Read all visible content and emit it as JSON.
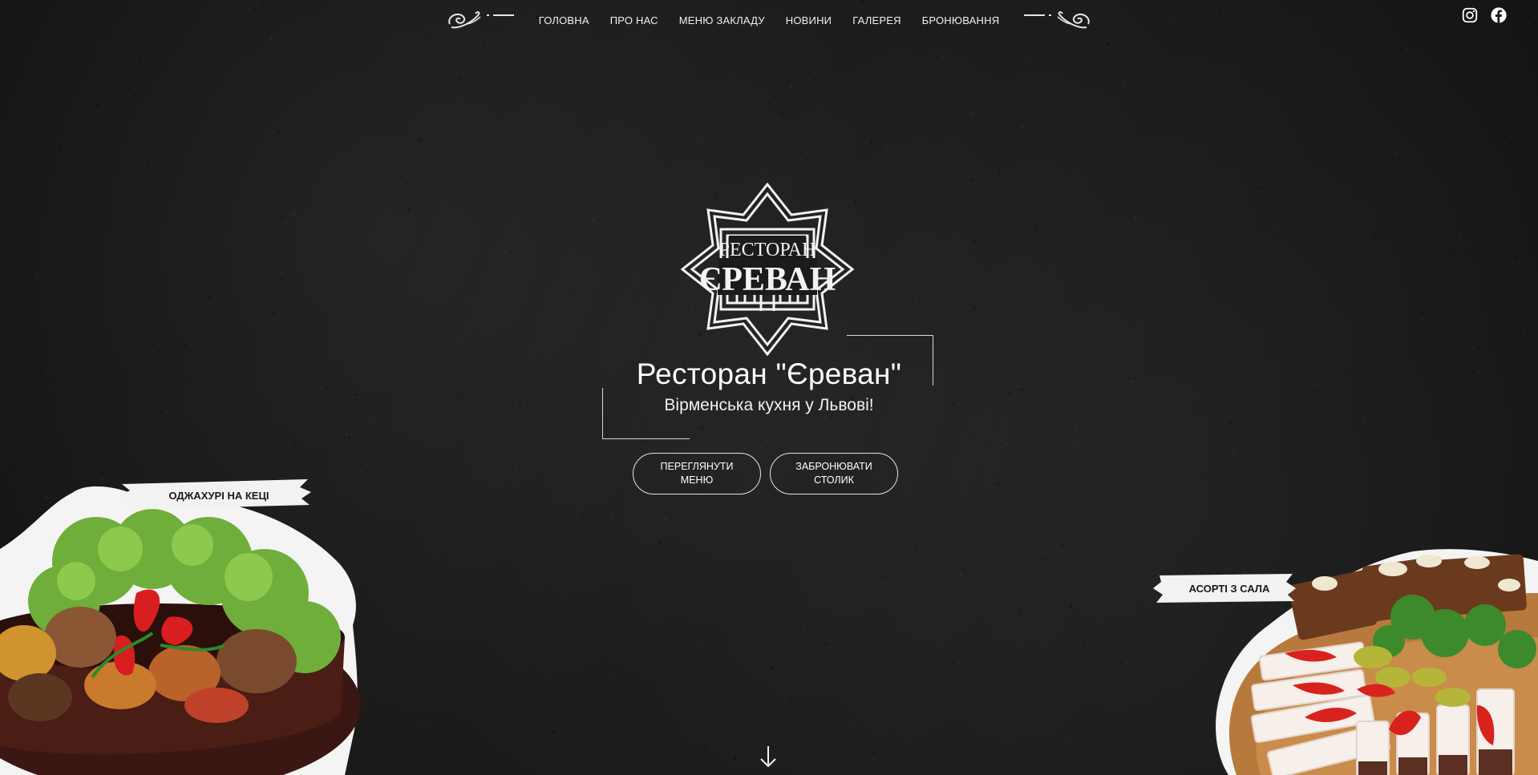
{
  "nav": {
    "items": [
      "ГОЛОВНА",
      "ПРО НАС",
      "МЕНЮ ЗАКЛАДУ",
      "НОВИНИ",
      "ГАЛЕРЕЯ",
      "БРОНЮВАННЯ"
    ]
  },
  "socials": {
    "icons": [
      "instagram-icon",
      "facebook-icon"
    ]
  },
  "logo": {
    "line1": "РЕСТОРАН",
    "line2": "ЄРЕВАН"
  },
  "hero": {
    "title": "Ресторан \"Єреван\"",
    "subtitle": "Вірменська кухня у Львові!",
    "btn_menu": "ПЕРЕГЛЯНУТИ МЕНЮ",
    "btn_book": "ЗАБРОНЮВАТИ СТОЛИК"
  },
  "dishes": {
    "left_label": "ОДЖАХУРІ НА КЕЦІ",
    "right_label": "АСОРТІ З САЛА"
  },
  "colors": {
    "background": "#1b1b1b",
    "text": "#ffffff",
    "label_bg": "#f2f2f2"
  }
}
